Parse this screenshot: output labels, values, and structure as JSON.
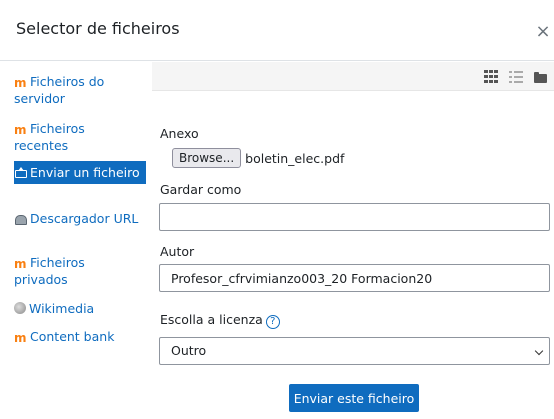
{
  "dialog": {
    "title": "Selector de ficheiros",
    "close_glyph": "×"
  },
  "sidebar": {
    "items": [
      {
        "label": "Ficheiros do servidor",
        "icon": "moodle-icon"
      },
      {
        "label": "Ficheiros recentes",
        "icon": "moodle-icon"
      },
      {
        "label": "Enviar un ficheiro",
        "icon": "upload-icon",
        "active": true
      },
      {
        "label": "Descargador URL",
        "icon": "download-icon"
      },
      {
        "label": "Ficheiros privados",
        "icon": "moodle-icon"
      },
      {
        "label": "Wikimedia",
        "icon": "globe-icon"
      },
      {
        "label": "Content bank",
        "icon": "moodle-icon"
      }
    ]
  },
  "toolbar": {
    "icons": [
      "grid-view-icon",
      "list-view-icon",
      "folder-view-icon"
    ]
  },
  "form": {
    "attachment_label": "Anexo",
    "browse_label": "Browse...",
    "file_name": "boletin_elec.pdf",
    "save_as_label": "Gardar como",
    "save_as_value": "",
    "author_label": "Autor",
    "author_value": "Profesor_cfrvimianzo003_20 Formacion20",
    "license_label": "Escolla a licenza",
    "license_help": "?",
    "license_selected": "Outro",
    "submit_label": "Enviar este ficheiro"
  },
  "colors": {
    "accent": "#0f6cbf",
    "moodle_orange": "#f98012"
  }
}
